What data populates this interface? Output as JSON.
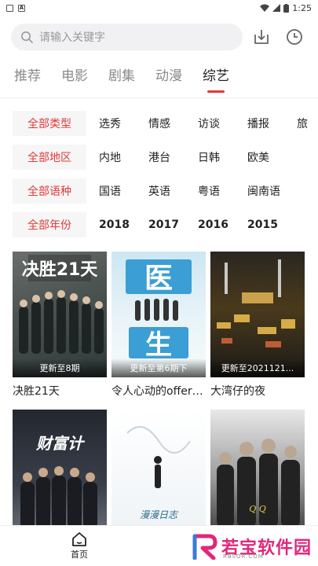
{
  "status": {
    "time": "1:25"
  },
  "search": {
    "placeholder": "请输入关键字"
  },
  "tabs": [
    "推荐",
    "电影",
    "剧集",
    "动漫",
    "综艺"
  ],
  "active_tab": 4,
  "filters": [
    {
      "label": "全部类型",
      "options": [
        "选秀",
        "情感",
        "访谈",
        "播报",
        "旅"
      ]
    },
    {
      "label": "全部地区",
      "options": [
        "内地",
        "港台",
        "日韩",
        "欧美"
      ]
    },
    {
      "label": "全部语种",
      "options": [
        "国语",
        "英语",
        "粤语",
        "闽南语"
      ]
    },
    {
      "label": "全部年份",
      "options": [
        "2018",
        "2017",
        "2016",
        "2015"
      ]
    }
  ],
  "cards": [
    {
      "title": "决胜21天",
      "badge": "更新至8期"
    },
    {
      "title": "令人心动的offer第三季",
      "badge": "更新至第6期下"
    },
    {
      "title": "大湾仔的夜",
      "badge": "更新至2021121..."
    },
    {
      "title": "",
      "badge": ""
    },
    {
      "title": "",
      "badge": ""
    },
    {
      "title": "",
      "badge": ""
    }
  ],
  "bottom_nav": {
    "home_label": "首页"
  },
  "watermark": {
    "text": "若宝软件园",
    "sub": "RBSOR.COM"
  },
  "colors": {
    "accent": "#e23a3a",
    "watermark": "#e0287a"
  }
}
